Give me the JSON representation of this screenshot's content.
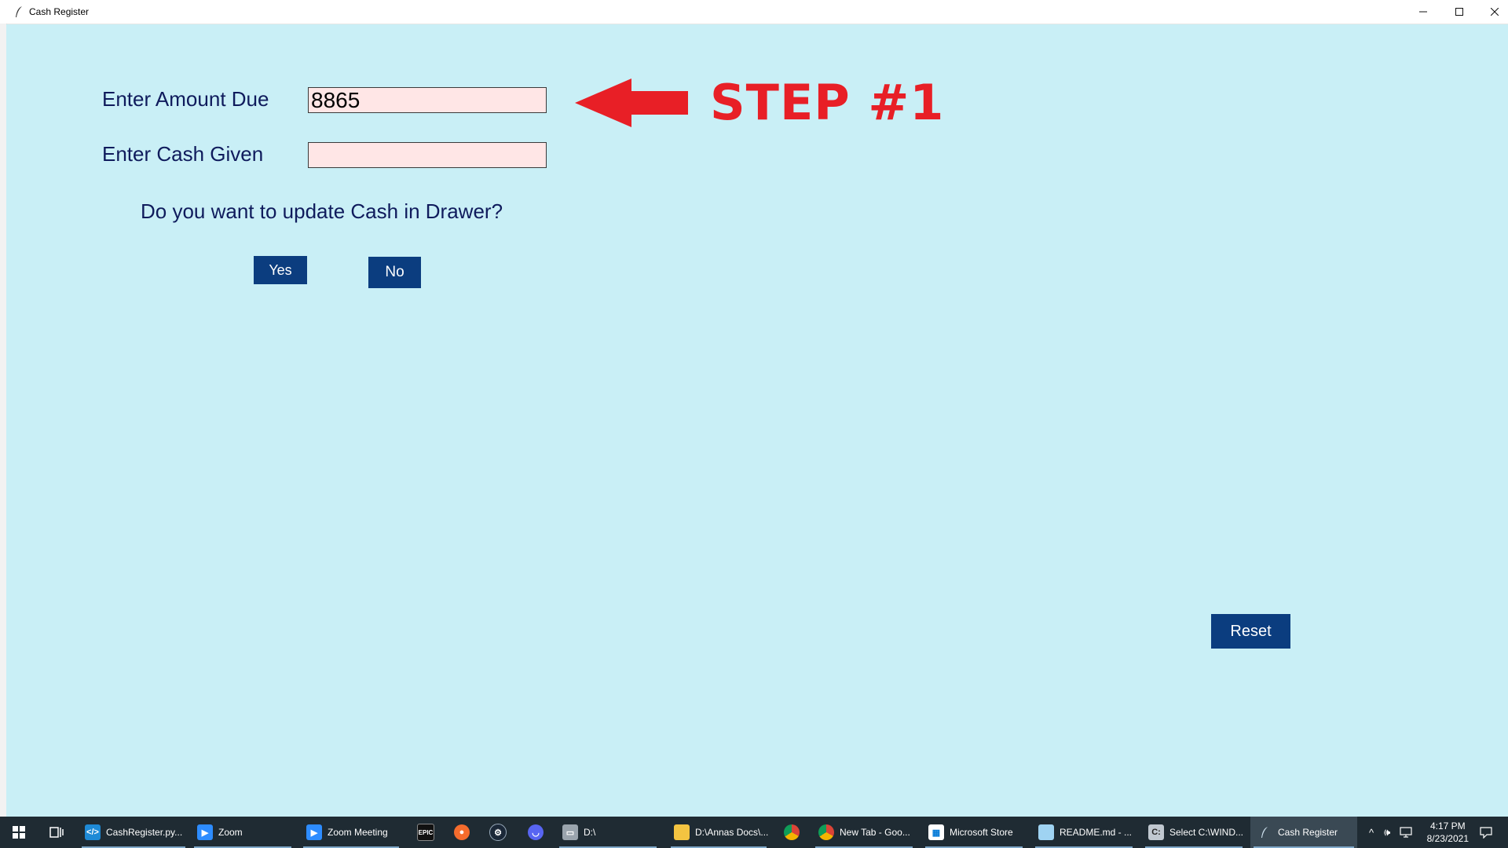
{
  "window": {
    "title": "Cash Register",
    "controls": {
      "minimize": "—",
      "maximize": "☐",
      "close": "✕"
    }
  },
  "form": {
    "amount_due_label": "Enter Amount Due",
    "amount_due_value": "8865",
    "cash_given_label": "Enter Cash Given",
    "cash_given_value": "",
    "update_prompt": "Do you want to update Cash in Drawer?",
    "yes_label": "Yes",
    "no_label": "No",
    "reset_label": "Reset"
  },
  "annotation": {
    "step_text": "STEP #1",
    "color": "#e81f26"
  },
  "colors": {
    "background": "#c9eff6",
    "label": "#0f1b5c",
    "button": "#0b3d7f",
    "entry": "#ffe6e6"
  },
  "taskbar": {
    "items": [
      {
        "label": "CashRegister.py...",
        "icon": "vscode-icon"
      },
      {
        "label": "Zoom",
        "icon": "zoom-icon"
      },
      {
        "label": "Zoom Meeting",
        "icon": "zoom-icon"
      },
      {
        "label": "",
        "icon": "epic-games-icon"
      },
      {
        "label": "",
        "icon": "origin-icon"
      },
      {
        "label": "",
        "icon": "steam-icon"
      },
      {
        "label": "",
        "icon": "discord-icon"
      },
      {
        "label": "D:\\",
        "icon": "drive-icon"
      },
      {
        "label": "D:\\Annas Docs\\...",
        "icon": "folder-icon"
      },
      {
        "label": "",
        "icon": "chrome-icon"
      },
      {
        "label": "New Tab - Goo...",
        "icon": "chrome-icon"
      },
      {
        "label": "Microsoft Store",
        "icon": "store-icon"
      },
      {
        "label": "README.md - ...",
        "icon": "notepad-icon"
      },
      {
        "label": "Select C:\\WIND...",
        "icon": "cmd-icon"
      },
      {
        "label": "Cash Register",
        "icon": "feather-icon"
      }
    ],
    "time": "4:17 PM",
    "date": "8/23/2021"
  }
}
